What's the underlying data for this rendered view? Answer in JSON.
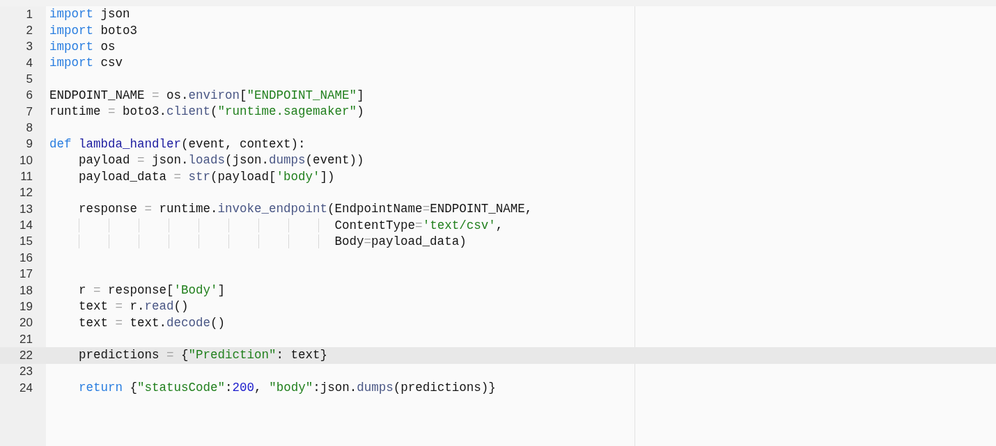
{
  "editor": {
    "lines": [
      {
        "number": "1",
        "selected": false,
        "tokens": [
          {
            "kind": "keyword",
            "text": "import"
          },
          {
            "kind": "plain",
            "text": " json"
          }
        ]
      },
      {
        "number": "2",
        "selected": false,
        "tokens": [
          {
            "kind": "keyword",
            "text": "import"
          },
          {
            "kind": "plain",
            "text": " boto3"
          }
        ]
      },
      {
        "number": "3",
        "selected": false,
        "tokens": [
          {
            "kind": "keyword",
            "text": "import"
          },
          {
            "kind": "plain",
            "text": " os"
          }
        ]
      },
      {
        "number": "4",
        "selected": false,
        "tokens": [
          {
            "kind": "keyword",
            "text": "import"
          },
          {
            "kind": "plain",
            "text": " csv"
          }
        ]
      },
      {
        "number": "5",
        "selected": false
      },
      {
        "number": "6",
        "selected": false,
        "tokens": [
          {
            "kind": "plain",
            "text": "ENDPOINT_NAME "
          },
          {
            "kind": "operator",
            "text": "="
          },
          {
            "kind": "plain",
            "text": " os."
          },
          {
            "kind": "property",
            "text": "environ"
          },
          {
            "kind": "plain",
            "text": "["
          },
          {
            "kind": "string",
            "text": "\"ENDPOINT_NAME\""
          },
          {
            "kind": "plain",
            "text": "]"
          }
        ]
      },
      {
        "number": "7",
        "selected": false,
        "tokens": [
          {
            "kind": "plain",
            "text": "runtime "
          },
          {
            "kind": "operator",
            "text": "="
          },
          {
            "kind": "plain",
            "text": " boto3."
          },
          {
            "kind": "property",
            "text": "client"
          },
          {
            "kind": "plain",
            "text": "("
          },
          {
            "kind": "string",
            "text": "\"runtime.sagemaker\""
          },
          {
            "kind": "plain",
            "text": ")"
          }
        ]
      },
      {
        "number": "8",
        "selected": false
      },
      {
        "number": "9",
        "selected": false,
        "tokens": [
          {
            "kind": "keyword",
            "text": "def "
          },
          {
            "kind": "definition",
            "text": "lambda_handler"
          },
          {
            "kind": "plain",
            "text": "(event, context):"
          }
        ]
      },
      {
        "number": "10",
        "selected": false,
        "tokens": [
          {
            "kind": "plain",
            "text": "    payload "
          },
          {
            "kind": "operator",
            "text": "="
          },
          {
            "kind": "plain",
            "text": " json."
          },
          {
            "kind": "property",
            "text": "loads"
          },
          {
            "kind": "plain",
            "text": "(json."
          },
          {
            "kind": "property",
            "text": "dumps"
          },
          {
            "kind": "plain",
            "text": "(event))"
          }
        ]
      },
      {
        "number": "11",
        "selected": false,
        "tokens": [
          {
            "kind": "plain",
            "text": "    payload_data "
          },
          {
            "kind": "operator",
            "text": "= "
          },
          {
            "kind": "builtin",
            "text": "str"
          },
          {
            "kind": "plain",
            "text": "(payload["
          },
          {
            "kind": "string",
            "text": "'body'"
          },
          {
            "kind": "plain",
            "text": "])"
          }
        ]
      },
      {
        "number": "12",
        "selected": false
      },
      {
        "number": "13",
        "selected": false,
        "tokens": [
          {
            "kind": "plain",
            "text": "    response "
          },
          {
            "kind": "operator",
            "text": "="
          },
          {
            "kind": "plain",
            "text": " runtime."
          },
          {
            "kind": "property",
            "text": "invoke_endpoint"
          },
          {
            "kind": "plain",
            "text": "(EndpointName"
          },
          {
            "kind": "operator",
            "text": "="
          },
          {
            "kind": "plain",
            "text": "ENDPOINT_NAME,"
          }
        ]
      },
      {
        "number": "14",
        "selected": false,
        "tokens": [
          {
            "kind": "plain",
            "text": "                                       ContentType"
          },
          {
            "kind": "operator",
            "text": "="
          },
          {
            "kind": "string",
            "text": "'text/csv'"
          },
          {
            "kind": "plain",
            "text": ","
          }
        ]
      },
      {
        "number": "15",
        "selected": false,
        "tokens": [
          {
            "kind": "plain",
            "text": "                                       Body"
          },
          {
            "kind": "operator",
            "text": "="
          },
          {
            "kind": "plain",
            "text": "payload_data)"
          }
        ]
      },
      {
        "number": "16",
        "selected": false
      },
      {
        "number": "17",
        "selected": false
      },
      {
        "number": "18",
        "selected": false,
        "tokens": [
          {
            "kind": "plain",
            "text": "    r "
          },
          {
            "kind": "operator",
            "text": "="
          },
          {
            "kind": "plain",
            "text": " response["
          },
          {
            "kind": "string",
            "text": "'Body'"
          },
          {
            "kind": "plain",
            "text": "]"
          }
        ]
      },
      {
        "number": "19",
        "selected": false,
        "tokens": [
          {
            "kind": "plain",
            "text": "    text "
          },
          {
            "kind": "operator",
            "text": "="
          },
          {
            "kind": "plain",
            "text": " r."
          },
          {
            "kind": "property",
            "text": "read"
          },
          {
            "kind": "plain",
            "text": "()"
          }
        ]
      },
      {
        "number": "20",
        "selected": false,
        "tokens": [
          {
            "kind": "plain",
            "text": "    text "
          },
          {
            "kind": "operator",
            "text": "="
          },
          {
            "kind": "plain",
            "text": " text."
          },
          {
            "kind": "property",
            "text": "decode"
          },
          {
            "kind": "plain",
            "text": "()"
          }
        ]
      },
      {
        "number": "21",
        "selected": false
      },
      {
        "number": "22",
        "selected": true,
        "tokens": [
          {
            "kind": "plain",
            "text": "    predictions "
          },
          {
            "kind": "operator",
            "text": "="
          },
          {
            "kind": "plain",
            "text": " {"
          },
          {
            "kind": "string",
            "text": "\"Prediction\""
          },
          {
            "kind": "plain",
            "text": ": text}"
          }
        ]
      },
      {
        "number": "23",
        "selected": false
      },
      {
        "number": "24",
        "selected": false,
        "tokens": [
          {
            "kind": "keyword",
            "text": "    return"
          },
          {
            "kind": "plain",
            "text": " {"
          },
          {
            "kind": "string",
            "text": "\"statusCode\""
          },
          {
            "kind": "plain",
            "text": ":"
          },
          {
            "kind": "number",
            "text": "200"
          },
          {
            "kind": "plain",
            "text": ", "
          },
          {
            "kind": "string",
            "text": "\"body\""
          },
          {
            "kind": "plain",
            "text": ":json."
          },
          {
            "kind": "property",
            "text": "dumps"
          },
          {
            "kind": "plain",
            "text": "(predictions)}"
          }
        ]
      }
    ]
  }
}
